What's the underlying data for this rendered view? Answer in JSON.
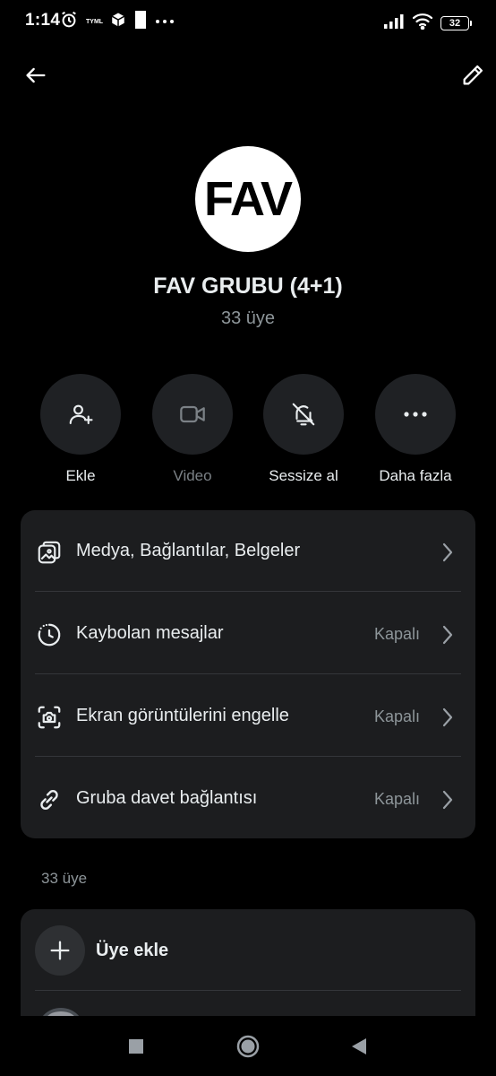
{
  "status_bar": {
    "time": "1:14",
    "carrier_tag": "TYML",
    "battery": "32"
  },
  "header": {
    "back_icon": "arrow-left-icon",
    "edit_icon": "pencil-icon"
  },
  "group": {
    "avatar_text": "FAV",
    "title": "FAV GRUBU (4+1)",
    "member_count": "33 üye"
  },
  "actions": [
    {
      "label": "Ekle",
      "icon": "add-person-icon",
      "enabled": true
    },
    {
      "label": "Video",
      "icon": "video-camera-icon",
      "enabled": false
    },
    {
      "label": "Sessize al",
      "icon": "bell-off-icon",
      "enabled": true
    },
    {
      "label": "Daha fazla",
      "icon": "more-dots-icon",
      "enabled": true
    }
  ],
  "settings": [
    {
      "label": "Medya, Bağlantılar, Belgeler",
      "value": "",
      "icon": "media-gallery-icon"
    },
    {
      "label": "Kaybolan mesajlar",
      "value": "Kapalı",
      "icon": "timer-icon"
    },
    {
      "label": "Ekran görüntülerini engelle",
      "value": "Kapalı",
      "icon": "screenshot-block-icon"
    },
    {
      "label": "Gruba davet bağlantısı",
      "value": "Kapalı",
      "icon": "link-icon"
    }
  ],
  "members": {
    "section_label": "33 üye",
    "add_label": "Üye ekle"
  },
  "colors": {
    "background": "#000000",
    "card": "#1c1d1f",
    "action_circle": "#1f2124",
    "text_primary": "#e9edef",
    "text_secondary": "#8d9599"
  }
}
